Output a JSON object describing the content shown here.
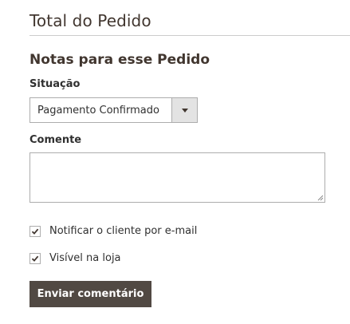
{
  "section": {
    "title": "Total do Pedido"
  },
  "notes": {
    "title": "Notas para esse Pedido",
    "status_label": "Situação",
    "status_value": "Pagamento Confirmado",
    "comment_label": "Comente",
    "comment_value": "",
    "notify_label": "Notificar o cliente por e-mail",
    "notify_checked": true,
    "visible_label": "Visível na loja",
    "visible_checked": true,
    "submit_label": "Enviar comentário"
  },
  "colors": {
    "text": "#41362f",
    "button_bg": "#514943",
    "button_text": "#ffffff",
    "border": "#adadad",
    "select_arrow_bg": "#e3e3e3"
  },
  "icons": {
    "select_arrow": "chevron-down-icon",
    "checkbox_mark": "checkmark-icon",
    "textarea_grip": "resize-grip-icon"
  }
}
